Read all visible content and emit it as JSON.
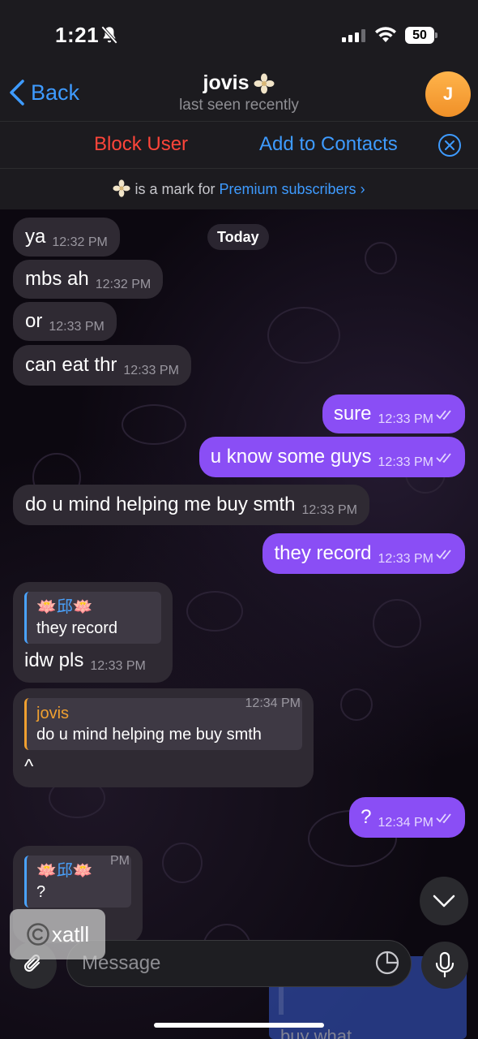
{
  "status_bar": {
    "time": "1:21",
    "battery": "50"
  },
  "header": {
    "back_label": "Back",
    "name": "jovis",
    "status": "last seen recently",
    "avatar_initial": "J",
    "avatar_color": "#f5a13a"
  },
  "actions": {
    "block_label": "Block User",
    "add_label": "Add to Contacts",
    "premium_prefix": "is a mark for",
    "premium_link": "Premium subscribers"
  },
  "date_label": "Today",
  "messages": [
    {
      "text": "ya",
      "time": "12:32 PM"
    },
    {
      "text": "mbs ah",
      "time": "12:32 PM"
    },
    {
      "text": "or",
      "time": "12:33 PM"
    },
    {
      "text": "can eat thr",
      "time": "12:33 PM"
    },
    {
      "text": "sure",
      "time": "12:33 PM"
    },
    {
      "text": "u know some guys",
      "time": "12:33 PM"
    },
    {
      "text": "do u mind helping me buy smth",
      "time": "12:33 PM"
    },
    {
      "text": "they record",
      "time": "12:33 PM"
    },
    {
      "reply_name": "🪷邱🪷",
      "reply_text": "they record",
      "text": "idw pls",
      "time": "12:33 PM"
    },
    {
      "reply_name": "jovis",
      "reply_text": "do u mind helping me buy smth",
      "text": "^",
      "time": "12:34 PM"
    },
    {
      "text": "?",
      "time": "12:34 PM"
    },
    {
      "reply_name": "🪷邱🪷",
      "reply_text": "?",
      "time": "PM"
    }
  ],
  "composer": {
    "placeholder": "Message"
  },
  "watermark": "xatll",
  "peek": {
    "reply": "^",
    "text": "buy what"
  },
  "colors": {
    "accent": "#3e9bff",
    "outgoing_bubble": "#8a4ef5",
    "incoming_bubble": "#2f2a33",
    "block_red": "#ff453a",
    "reply_accent_green": "#4aa3ff",
    "reply_accent_orange": "#f0a030"
  }
}
